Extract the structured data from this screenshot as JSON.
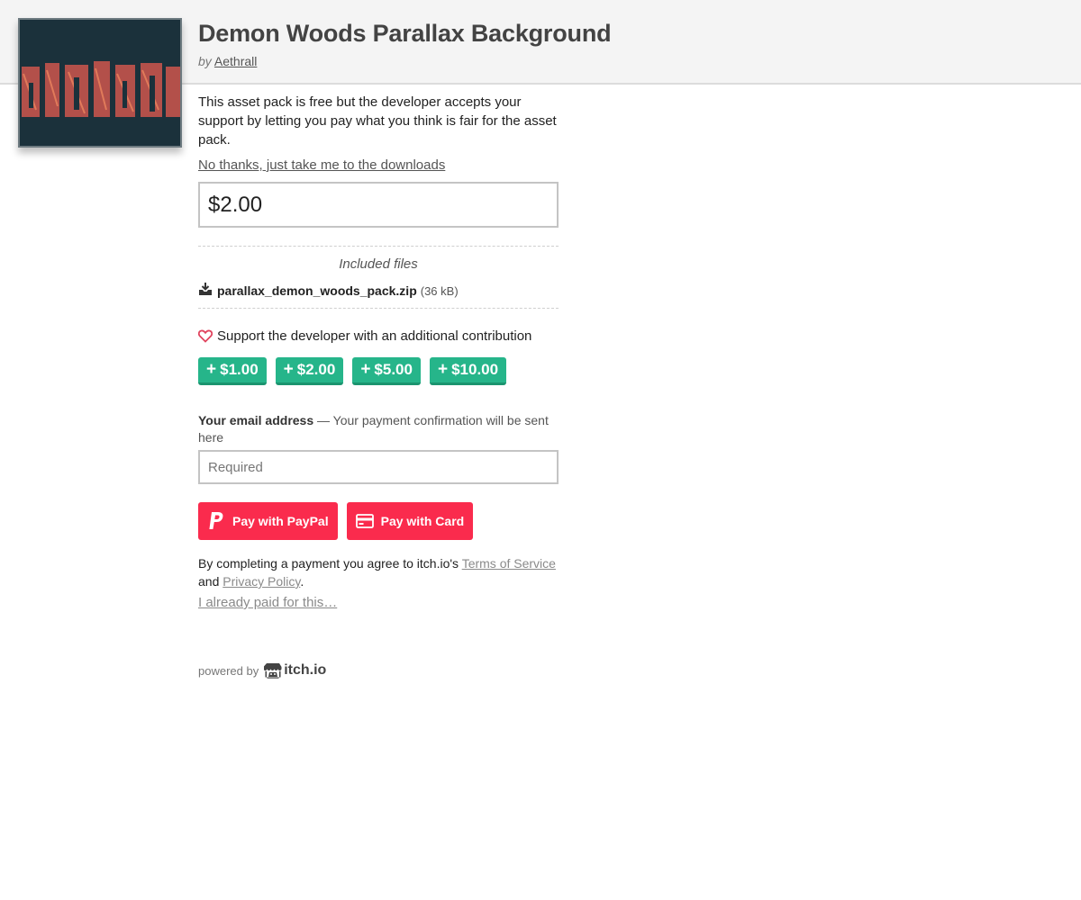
{
  "header": {
    "title": "Demon Woods Parallax Background",
    "by": "by",
    "author": "Aethrall"
  },
  "intro": "This asset pack is free but the developer accepts your support by letting you pay what you think is fair for the asset pack.",
  "skip_link": "No thanks, just take me to the downloads",
  "price": "$2.00",
  "files": {
    "label": "Included files",
    "items": [
      {
        "name": "parallax_demon_woods_pack.zip",
        "size": "(36 kB)"
      }
    ]
  },
  "support": {
    "text": "Support the developer with an additional contribution",
    "tips": [
      "$1.00",
      "$2.00",
      "$5.00",
      "$10.00"
    ]
  },
  "email": {
    "label": "Your email address",
    "note": " — Your payment confirmation will be sent here",
    "placeholder": "Required"
  },
  "pay": {
    "paypal": "Pay with PayPal",
    "card": "Pay with Card"
  },
  "terms": {
    "prefix": "By completing a payment you agree to itch.io's ",
    "tos": "Terms of Service",
    "and": "and ",
    "privacy": "Privacy Policy",
    "suffix": "."
  },
  "already_paid": "I already paid for this…",
  "powered": {
    "text": "powered by",
    "brand": "itch.io"
  },
  "colors": {
    "tip_green": "#26b58a",
    "pay_red": "#fa2b4d",
    "header_bg": "#f4f4f4"
  },
  "icons": [
    "download-icon",
    "heart-icon",
    "plus-icon",
    "paypal-icon",
    "card-icon",
    "itchio-logo-icon"
  ]
}
